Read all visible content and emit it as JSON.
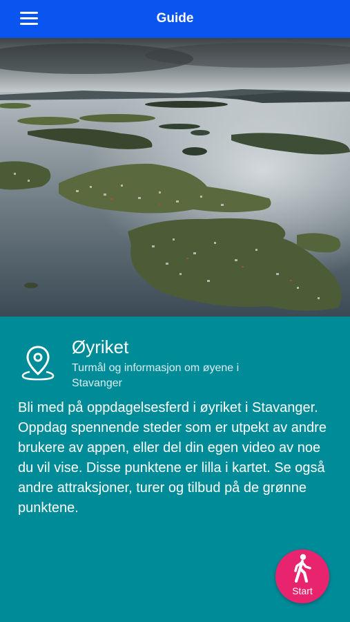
{
  "header": {
    "title": "Guide",
    "menu_icon": "hamburger-menu-icon",
    "background_color": "#0a55f0"
  },
  "hero": {
    "image_description": "Aerial photo of islands in a fjord",
    "image_kind": "photo"
  },
  "info": {
    "icon": "location-pin-icon",
    "heading": "Øyriket",
    "subtitle": "Turmål og informasjon om øyene i Stavanger",
    "description": "Bli med på oppdagelsesferd i øyriket i Stavanger. Oppdag spennende steder som er utpekt av andre brukere av appen, eller del din egen video av noe du vil vise. Disse punktene er lilla i kartet. Se også andre attraksjoner, turer og tilbud på de grønne punktene.",
    "background_color": "#008b99"
  },
  "start_button": {
    "label": "Start",
    "icon": "walking-person-icon",
    "color": "#e8246e"
  }
}
